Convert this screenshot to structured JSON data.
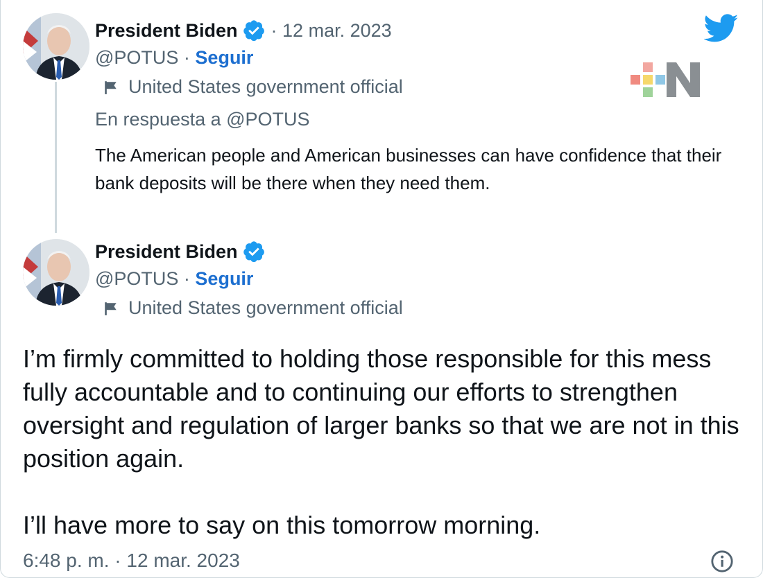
{
  "reply_tweet": {
    "author_name": "President Biden",
    "handle": "@POTUS",
    "separator": " · ",
    "follow_label": "Seguir",
    "date": "· 12 mar. 2023",
    "account_label": "United States government official",
    "reply_context": "En respuesta a @POTUS",
    "text": "The American people and American businesses can have confidence that their bank deposits will be there when they need them."
  },
  "main_tweet": {
    "author_name": "President Biden",
    "handle": "@POTUS",
    "separator": " · ",
    "follow_label": "Seguir",
    "account_label": "United States government official",
    "text": "I’m firmly committed to holding those responsible for this mess fully accountable and to continuing our efforts to strengthen oversight and regulation of larger banks so that we are not in this position again.\n\nI’ll have more to say on this tomorrow morning.",
    "timestamp": "6:48 p. m. · 12 mar. 2023"
  },
  "icons": {
    "verified": "verified-badge-icon",
    "label_flag": "flag-icon",
    "twitter": "twitter-bird-icon",
    "info": "info-icon",
    "brand": "plus-n-logo"
  },
  "colors": {
    "text": "#0f1419",
    "secondary": "#536471",
    "link": "#1d6fd0",
    "twitter_blue": "#1d9bf0",
    "verified": "#1d9bf0"
  }
}
